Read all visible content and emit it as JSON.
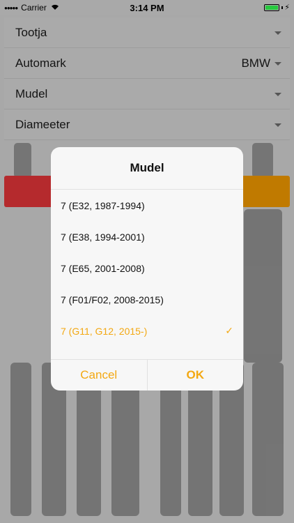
{
  "statusbar": {
    "carrier": "Carrier",
    "time": "3:14 PM",
    "battery_level": 1.0
  },
  "form": {
    "rows": [
      {
        "label": "Tootja",
        "value": ""
      },
      {
        "label": "Automark",
        "value": "BMW"
      },
      {
        "label": "Mudel",
        "value": ""
      },
      {
        "label": "Diameeter",
        "value": ""
      }
    ]
  },
  "dialog": {
    "title": "Mudel",
    "options": [
      {
        "label": "7 (E32, 1987-1994)",
        "selected": false
      },
      {
        "label": "7 (E38, 1994-2001)",
        "selected": false
      },
      {
        "label": "7 (E65, 2001-2008)",
        "selected": false
      },
      {
        "label": "7 (F01/F02, 2008-2015)",
        "selected": false
      },
      {
        "label": "7 (G11, G12, 2015-)",
        "selected": true
      }
    ],
    "cancel_label": "Cancel",
    "ok_label": "OK"
  },
  "colors": {
    "accent": "#f3a812",
    "red_button": "#b52a2d",
    "orange_button": "#c07a00",
    "battery": "#27c93f"
  },
  "icons": {
    "signal": "signal-icon",
    "wifi": "wifi-icon",
    "battery": "battery-icon",
    "charging": "charging-bolt-icon",
    "chevron": "chevron-down-icon",
    "check": "checkmark-icon"
  }
}
